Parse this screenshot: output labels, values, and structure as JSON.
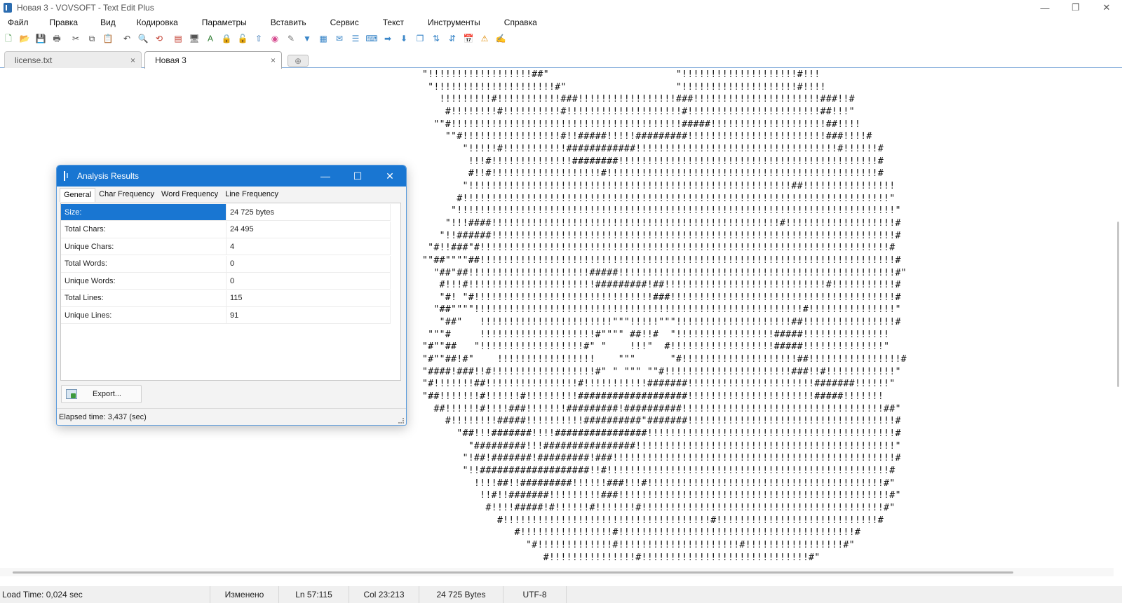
{
  "window": {
    "title": "Новая 3 - VOVSOFT - Text Edit Plus",
    "controls": [
      "—",
      "❐",
      "✕"
    ]
  },
  "menu": [
    "Файл",
    "Правка",
    "Вид",
    "Кодировка",
    "Параметры",
    "Вставить",
    "Сервис",
    "Текст",
    "Инструменты",
    "Справка"
  ],
  "toolbar": [
    {
      "icon": "new-icon",
      "glyph": "🗋",
      "color": "#3b8f3b"
    },
    {
      "icon": "open-icon",
      "glyph": "📂",
      "color": "#d9a23a"
    },
    {
      "icon": "save-icon",
      "glyph": "💾",
      "color": "#2b6cb0"
    },
    {
      "icon": "print-icon",
      "glyph": "🖶",
      "color": "#666666"
    },
    {
      "icon": "cut-icon",
      "glyph": "✂",
      "color": "#555555"
    },
    {
      "icon": "copy-icon",
      "glyph": "⧉",
      "color": "#555555"
    },
    {
      "icon": "paste-icon",
      "glyph": "📋",
      "color": "#b07d2b"
    },
    {
      "icon": "undo-icon",
      "glyph": "↶",
      "color": "#444444"
    },
    {
      "icon": "find-icon",
      "glyph": "🔍",
      "color": "#444444"
    },
    {
      "icon": "replace-icon",
      "glyph": "⟲",
      "color": "#c0392b"
    },
    {
      "icon": "pdf-icon",
      "glyph": "▤",
      "color": "#c0392b"
    },
    {
      "icon": "monitor-icon",
      "glyph": "🖥",
      "color": "#555555"
    },
    {
      "icon": "font-icon",
      "glyph": "A",
      "color": "#2e7d32"
    },
    {
      "icon": "lock-icon",
      "glyph": "🔒",
      "color": "#c8922a"
    },
    {
      "icon": "unlock-icon",
      "glyph": "🔓",
      "color": "#c8922a"
    },
    {
      "icon": "export-icon",
      "glyph": "⇧",
      "color": "#2b6cb0"
    },
    {
      "icon": "color-icon",
      "glyph": "◉",
      "color": "#d64b8f"
    },
    {
      "icon": "brush-icon",
      "glyph": "✎",
      "color": "#777777"
    },
    {
      "icon": "filter-icon",
      "glyph": "▼",
      "color": "#3a86c8"
    },
    {
      "icon": "table-icon",
      "glyph": "▦",
      "color": "#3a86c8"
    },
    {
      "icon": "mail-icon",
      "glyph": "✉",
      "color": "#3a86c8"
    },
    {
      "icon": "list-icon",
      "glyph": "☰",
      "color": "#3a86c8"
    },
    {
      "icon": "keyboard-icon",
      "glyph": "⌨",
      "color": "#3a86c8"
    },
    {
      "icon": "forward-icon",
      "glyph": "➡",
      "color": "#3a86c8"
    },
    {
      "icon": "down-icon",
      "glyph": "⬇",
      "color": "#3a86c8"
    },
    {
      "icon": "window-icon",
      "glyph": "❐",
      "color": "#3a86c8"
    },
    {
      "icon": "sort-az-icon",
      "glyph": "⇅",
      "color": "#3a86c8"
    },
    {
      "icon": "sort-za-icon",
      "glyph": "⇵",
      "color": "#3a86c8"
    },
    {
      "icon": "calendar-icon",
      "glyph": "📅",
      "color": "#c0392b"
    },
    {
      "icon": "warning-icon",
      "glyph": "⚠",
      "color": "#e08a00"
    },
    {
      "icon": "note-icon",
      "glyph": "✍",
      "color": "#c8a02a"
    }
  ],
  "tabs": [
    {
      "label": "license.txt",
      "close": "×"
    },
    {
      "label": "Новая 3",
      "close": "×"
    }
  ],
  "newtab_glyph": "⊕",
  "editor": {
    "lines": [
      "\"!!!!!!!!!!!!!!!!!!##\"                      \"!!!!!!!!!!!!!!!!!!!!#!!!",
      " \"!!!!!!!!!!!!!!!!!!!!!#\"                   \"!!!!!!!!!!!!!!!!!!!!#!!!!",
      "   !!!!!!!!!#!!!!!!!!!!!###!!!!!!!!!!!!!!!!!###!!!!!!!!!!!!!!!!!!!!!!###!!#",
      "    #!!!!!!!!#!!!!!!!!!!#!!!!!!!!!!!!!!!!!!!!#!!!!!!!!!!!!!!!!!!!!!!!##!!!\"",
      "  \"\"#!!!!!!!!!!!!!!!!!!!!!!!!!!!!!!!!!!!!!!!!#####!!!!!!!!!!!!!!!!!!!!##!!!!",
      "    \"\"#!!!!!!!!!!!!!!!!!#!!#####!!!!!#########!!!!!!!!!!!!!!!!!!!!!!!!###!!!!#",
      "       \"!!!!!#!!!!!!!!!!!############!!!!!!!!!!!!!!!!!!!!!!!!!!!!!!!!!!!#!!!!!!#",
      "        !!!#!!!!!!!!!!!!!!########!!!!!!!!!!!!!!!!!!!!!!!!!!!!!!!!!!!!!!!!!!!!!#",
      "        #!!#!!!!!!!!!!!!!!!!!!!#!!!!!!!!!!!!!!!!!!!!!!!!!!!!!!!!!!!!!!!!!!!!!!!#",
      "       \"!!!!!!!!!!!!!!!!!!!!!!!!!!!!!!!!!!!!!!!!!!!!!!!!!!!!!!!!##!!!!!!!!!!!!!!!!",
      "      #!!!!!!!!!!!!!!!!!!!!!!!!!!!!!!!!!!!!!!!!!!!!!!!!!!!!!!!!!!!!!!!!!!!!!!!!!!\"",
      "     \"!!!!!!!!!!!!!!!!!!!!!!!!!!!!!!!!!!!!!!!!!!!!!!!!!!!!!!!!!!!!!!!!!!!!!!!!!!!!\"",
      "    \"!!!####!!!!!!!!!!!!!!!!!!!!!!!!!!!!!!!!!!!!!!!!!!!!!!!!!!#!!!!!!!!!!!!!!!!!!!#",
      "   \"!!######!!!!!!!!!!!!!!!!!!!!!!!!!!!!!!!!!!!!!!!!!!!!!!!!!!!!!!!!!!!!!!!!!!!!!!#",
      " \"#!!###\"#!!!!!!!!!!!!!!!!!!!!!!!!!!!!!!!!!!!!!!!!!!!!!!!!!!!!!!!!!!!!!!!!!!!!!!!#",
      "\"\"##\"\"\"\"##!!!!!!!!!!!!!!!!!!!!!!!!!!!!!!!!!!!!!!!!!!!!!!!!!!!!!!!!!!!!!!!!!!!!!!!!#",
      "  \"##\"##!!!!!!!!!!!!!!!!!!!!!#####!!!!!!!!!!!!!!!!!!!!!!!!!!!!!!!!!!!!!!!!!!!!!!!!#\"",
      "   #!!!#!!!!!!!!!!!!!!!!!!!!!!#########!##!!!!!!!!!!!!!!!!!!!!!!!!!!!!#!!!!!!!!!!!#",
      "   \"#! \"#!!!!!!!!!!!!!!!!!!!!!!!!!!!!!!!###!!!!!!!!!!!!!!!!!!!!!!!!!!!!!!!!!!!!!!!#",
      "  \"##\"\"\"\"!!!!!!!!!!!!!!!!!!!!!!!!!!!!!!!!!!!!!!!!!!!!!!!!!!!!!!!!!#!!!!!!!!!!!!!!!\"",
      "   \"##\"   !!!!!!!!!!!!!!!!!!!!!!!\"\"\"!!!!!\"\"\"!!!!!!!!!!!!!!!!!!!!##!!!!!!!!!!!!!!!!#",
      " \"\"\"#     !!!!!!!!!!!!!!!!!!!!#\"\"\"\" ##!!#  \"!!!!!!!!!!!!!!!!!#####!!!!!!!!!!!!!!!",
      "\"#\"\"##   \"!!!!!!!!!!!!!!!!!!#\" \"    !!!\"  #!!!!!!!!!!!!!!!!!!#####!!!!!!!!!!!!!!\"",
      "\"#\"\"##!#\"    !!!!!!!!!!!!!!!!!    \"\"\"      \"#!!!!!!!!!!!!!!!!!!!!##!!!!!!!!!!!!!!!!#",
      "\"####!###!!#!!!!!!!!!!!!!!!!!!#\" \" \"\"\" \"\"#!!!!!!!!!!!!!!!!!!!!!!###!!#!!!!!!!!!!!!\"",
      "\"#!!!!!!!##!!!!!!!!!!!!!!!!#!!!!!!!!!!!#######!!!!!!!!!!!!!!!!!!!!!!#######!!!!!!\"",
      "\"##!!!!!!!#!!!!!!#!!!!!!!!!###################!!!!!!!!!!!!!!!!!!!!!!#####!!!!!!!",
      "  ##!!!!!!#!!!!###!!!!!!!#########!##########!!!!!!!!!!!!!!!!!!!!!!!!!!!!!!!!!!!##\"",
      "    #!!!!!!!!#####!!!!!!!!!!##########\"#######!!!!!!!!!!!!!!!!!!!!!!!!!!!!!!!!!!!!#",
      "      \"##!!!#######!!!!################!!!!!!!!!!!!!!!!!!!!!!!!!!!!!!!!!!!!!!!!!!!#",
      "        \"#########!!!################!!!!!!!!!!!!!!!!!!!!!!!!!!!!!!!!!!!!!!!!!!!!!\"",
      "       \"!##!#######!#########!###!!!!!!!!!!!!!!!!!!!!!!!!!!!!!!!!!!!!!!!!!!!!!!!!!#",
      "       \"!!###################!!#!!!!!!!!!!!!!!!!!!!!!!!!!!!!!!!!!!!!!!!!!!!!!!!!!#",
      "         !!!!##!!#########!!!!!!###!!!#!!!!!!!!!!!!!!!!!!!!!!!!!!!!!!!!!!!!!!!!!#\"",
      "          !!#!!#######!!!!!!!!!###!!!!!!!!!!!!!!!!!!!!!!!!!!!!!!!!!!!!!!!!!!!!!!!#\"",
      "           #!!!!#####!#!!!!!!#!!!!!!!#!!!!!!!!!!!!!!!!!!!!!!!!!!!!!!!!!!!!!!!!!!#\"",
      "             #!!!!!!!!!!!!!!!!!!!!!!!!!!!!!!!!!!!!#!!!!!!!!!!!!!!!!!!!!!!!!!!!!#",
      "                #!!!!!!!!!!!!!!!!#!!!!!!!!!!!!!!!!!!!!!!!!!!!!!!!!!!!!!!!!!#",
      "                  \"#!!!!!!!!!!!!!#!!!!!!!!!!!!!!!!!!!!!#!!!!!!!!!!!!!!!!!#\"",
      "                     #!!!!!!!!!!!!!!!#!!!!!!!!!!!!!!!!!!!!!!!!!!!!!#\""
    ]
  },
  "statusbar": {
    "load_time": "Load Time: 0,024 sec",
    "modified": "Изменено",
    "line": "Ln 57:115",
    "col": "Col 23:213",
    "size": "24 725 Bytes",
    "encoding": "UTF-8"
  },
  "dialog": {
    "title": "Analysis Results",
    "controls": [
      "—",
      "☐",
      "✕"
    ],
    "tabs": [
      "General",
      "Char Frequency",
      "Word Frequency",
      "Line Frequency"
    ],
    "active_tab": "General",
    "rows": [
      {
        "name": "Size:",
        "value": "24 725 bytes",
        "selected": true
      },
      {
        "name": "Total Chars:",
        "value": "24 495"
      },
      {
        "name": "Unique Chars:",
        "value": "4"
      },
      {
        "name": "Total Words:",
        "value": "0"
      },
      {
        "name": "Unique Words:",
        "value": "0"
      },
      {
        "name": "Total Lines:",
        "value": "115"
      },
      {
        "name": "Unique Lines:",
        "value": "91"
      }
    ],
    "export_label": "Export...",
    "status": "Elapsed time: 3,437 (sec)",
    "accent": "#1976d2"
  }
}
